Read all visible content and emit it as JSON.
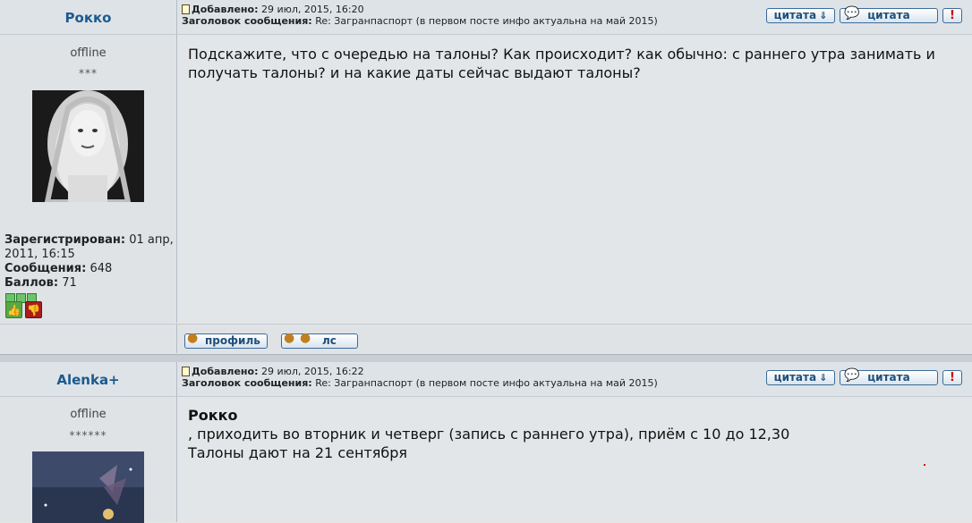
{
  "posts": [
    {
      "author": "Рокко",
      "status": "offline",
      "rank_stars": "***",
      "added_label": "Добавлено:",
      "added_date": "29 июл, 2015, 16:20",
      "subject_label": "Заголовок сообщения:",
      "subject": "Re: Загранпаспорт (в первом посте инфо актуальна на май 2015)",
      "quote_btn1": "цитата",
      "quote_btn2": "цитата",
      "report_btn": "!",
      "registered_label": "Зарегистрирован:",
      "registered_value": "01 апр, 2011, 16:15",
      "messages_label": "Сообщения:",
      "messages_value": "648",
      "points_label": "Баллов:",
      "points_value": "71",
      "message_line1": "Подскажите, что с очередью на талоны? Как происходит? как обычно: с раннего утра занимать и",
      "message_line2": "получать талоны? и на какие даты сейчас выдают талоны?",
      "profile_btn": "профиль",
      "pm_btn": "лс"
    },
    {
      "author": "Alenka+",
      "status": "offline",
      "rank_stars": "******",
      "added_label": "Добавлено:",
      "added_date": "29 июл, 2015, 16:22",
      "subject_label": "Заголовок сообщения:",
      "subject": "Re: Загранпаспорт (в первом посте инфо актуальна на май 2015)",
      "quote_btn1": "цитата",
      "quote_btn2": "цитата",
      "report_btn": "!",
      "reply_to": "Рокко",
      "message_line1": ", приходить во вторник и четверг (запись с раннего утра), приём с 10 до 12,30",
      "message_line2": "Талоны дают на 21 сентября"
    }
  ],
  "colors": {
    "nick": "#1b5a8f",
    "button_border": "#3b6b9a",
    "vote_up": "#5aa646",
    "vote_down": "#a81e1e"
  },
  "icons": {
    "post": "post-icon",
    "quote_arrows": "double-chevron-down-icon",
    "quote_bubble": "speech-bubble-icon",
    "report": "exclamation-icon",
    "profile": "user-icon",
    "pm": "two-users-icon",
    "thumb_up": "thumbs-up-icon",
    "thumb_down": "thumbs-down-icon"
  }
}
